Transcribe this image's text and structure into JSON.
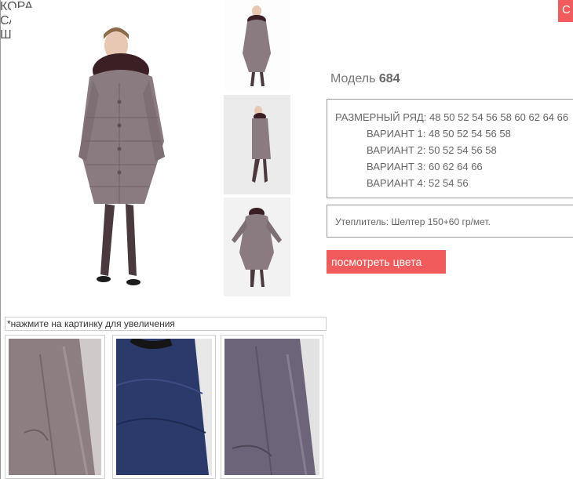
{
  "header": {
    "corner_button_label": "С"
  },
  "product": {
    "model_prefix": "Модель",
    "model_number": "684",
    "size_range": "РАЗМЕРНЫЙ РЯД: 48 50 52 54 56 58 60 62 64 66",
    "variants": [
      "ВАРИАНТ 1: 48 50 52 54 56 58",
      "ВАРИАНТ 2: 50 52 54 56 58",
      "ВАРИАНТ 3: 60 62 64 66",
      "ВАРИАНТ 4: 52 54 56"
    ],
    "insulation": "Утеплитель: Шелтер 150+60 гр/мет.",
    "view_colors_label": "посмотреть цвета"
  },
  "gallery": {
    "hint": "*нажмите на картинку для увеличения",
    "swatches": [
      {
        "label": "КОРА",
        "color": "#8d7e82"
      },
      {
        "label": "САПФИР",
        "color": "#2c3a6b"
      },
      {
        "label": "ШАРК",
        "color": "#6c6478"
      }
    ]
  },
  "colors": {
    "accent": "#f25b5b",
    "tag": "#e3585c",
    "coat": "#8a7b80"
  }
}
